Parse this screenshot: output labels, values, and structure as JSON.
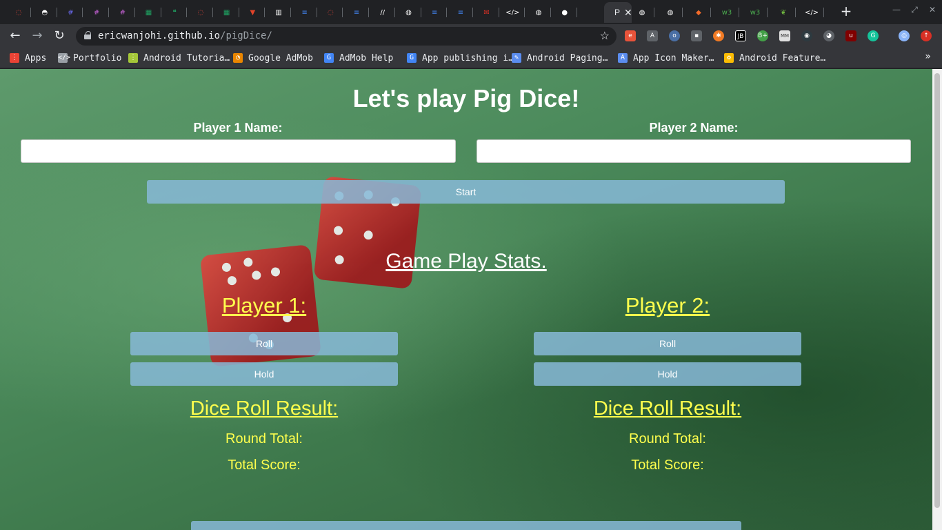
{
  "browser": {
    "tabs": [
      {
        "icon": "circle-dots-icon",
        "color": "#e5483a"
      },
      {
        "icon": "helmet-icon",
        "color": "#ffffff"
      },
      {
        "icon": "slack-icon",
        "color": "#6a6af0"
      },
      {
        "icon": "slack-icon",
        "color": "#c05fd0"
      },
      {
        "icon": "slack-icon",
        "color": "#c05fd0"
      },
      {
        "icon": "sheets-icon",
        "color": "#1fa463"
      },
      {
        "icon": "hangouts-icon",
        "color": "#1fa463"
      },
      {
        "icon": "circle-dots-icon",
        "color": "#e5483a"
      },
      {
        "icon": "sheets-icon",
        "color": "#1fa463"
      },
      {
        "icon": "gitlab-icon",
        "color": "#e24329"
      },
      {
        "icon": "trello-icon",
        "color": "#ffffff"
      },
      {
        "icon": "docs-icon",
        "color": "#4285f4"
      },
      {
        "icon": "circle-dots-icon",
        "color": "#e5483a"
      },
      {
        "icon": "docs-icon",
        "color": "#4285f4"
      },
      {
        "icon": "stroke-icon",
        "color": "#ffffff"
      },
      {
        "icon": "globe-icon",
        "color": "#ffffff"
      },
      {
        "icon": "docs-icon",
        "color": "#4285f4"
      },
      {
        "icon": "docs-icon",
        "color": "#4285f4"
      },
      {
        "icon": "gmail-icon",
        "color": "#d93025"
      },
      {
        "icon": "code-icon",
        "color": "#ffffff"
      },
      {
        "icon": "globe-icon",
        "color": "#ffffff"
      },
      {
        "icon": "github-icon",
        "color": "#ffffff"
      }
    ],
    "active_tab": {
      "title": "P",
      "close": "✕"
    },
    "tabs_after": [
      {
        "icon": "globe-icon",
        "color": "#ffffff"
      },
      {
        "icon": "globe-icon",
        "color": "#ffffff"
      },
      {
        "icon": "brave-icon",
        "color": "#f26b2a"
      },
      {
        "icon": "w3-icon",
        "color": "#4caf50"
      },
      {
        "icon": "w3-icon",
        "color": "#4caf50"
      },
      {
        "icon": "leaf-icon",
        "color": "#6db33f"
      },
      {
        "icon": "code-icon",
        "color": "#ffffff"
      }
    ],
    "new_tab": "+",
    "url_host": "ericwanjohi.github.io",
    "url_path": "/pigDice/",
    "bookmarks": [
      {
        "label": "Apps",
        "icon": "apps-grid-icon",
        "color": "#ea4335"
      },
      {
        "label": "Portfolio",
        "icon": "code-icon",
        "color": "#9aa0a6"
      },
      {
        "label": "Android Tutoria…",
        "icon": "list-icon",
        "color": "#a4c639"
      },
      {
        "label": "Google AdMob",
        "icon": "admob-icon",
        "color": "#ea8600"
      },
      {
        "label": "AdMob Help",
        "icon": "google-icon",
        "color": "#4285f4"
      },
      {
        "label": "App publishing i…",
        "icon": "google-icon",
        "color": "#4285f4"
      },
      {
        "label": "Android Paging…",
        "icon": "bookmark-icon",
        "color": "#5b8def"
      },
      {
        "label": "App Icon Maker…",
        "icon": "appstore-icon",
        "color": "#5b8def"
      },
      {
        "label": "Android Feature…",
        "icon": "photos-icon",
        "color": "#fbbc04"
      }
    ]
  },
  "page": {
    "title": "Let's play Pig Dice!",
    "player1_label": "Player 1 Name:",
    "player2_label": "Player 2 Name:",
    "player1_value": "",
    "player2_value": "",
    "start_label": "Start",
    "stats_heading": "Game Play Stats.",
    "player1_heading": "Player 1:",
    "player2_heading": "Player 2:",
    "roll_label": "Roll",
    "hold_label": "Hold",
    "dice_result": "Dice Roll Result:",
    "round_total": "Round Total:",
    "total_score": "Total Score:"
  },
  "colors": {
    "heading_yellow": "#ffff4d",
    "button_blue": "#87b9d7",
    "felt_green": "#4b8a5b"
  }
}
